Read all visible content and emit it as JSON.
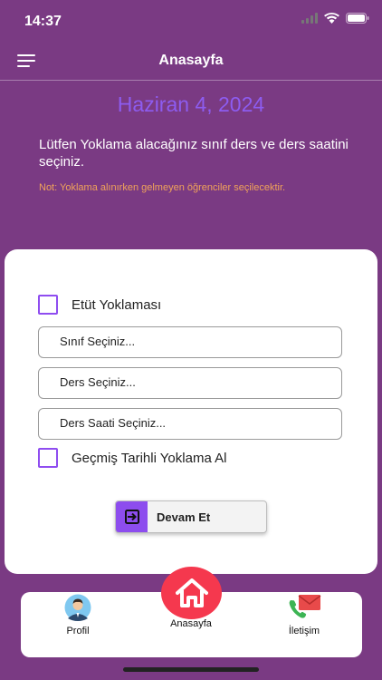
{
  "status_bar": {
    "time": "14:37"
  },
  "nav": {
    "title": "Anasayfa",
    "menu_icon": "hamburger-menu-icon"
  },
  "header": {
    "date": "Haziran 4, 2024",
    "instruction": "Lütfen Yoklama alacağınız sınıf ders ve ders saatini seçiniz.",
    "note": "Not: Yoklama alınırken gelmeyen öğrenciler seçilecektir."
  },
  "form": {
    "etut_checkbox": {
      "label": "Etüt Yoklaması",
      "checked": false
    },
    "class_select": {
      "placeholder": "Sınıf Seçiniz..."
    },
    "lesson_select": {
      "placeholder": "Ders Seçiniz..."
    },
    "lesson_hour_select": {
      "placeholder": "Ders Saati Seçiniz..."
    },
    "past_date_checkbox": {
      "label": "Geçmiş Tarihli Yoklama Al",
      "checked": false
    },
    "continue_button": {
      "label": "Devam Et",
      "icon": "enter-arrow-icon"
    }
  },
  "tab_bar": {
    "profile": {
      "label": "Profil",
      "icon": "profile-avatar-icon"
    },
    "home": {
      "label": "Anasayfa",
      "icon": "home-icon"
    },
    "contact": {
      "label": "İletişim",
      "icon": "phone-mail-icon"
    }
  },
  "colors": {
    "background": "#7a3a83",
    "accent": "#8d4dee",
    "date": "#8d5cf0",
    "note": "#f0a35a",
    "home_fab": "#f5384e"
  }
}
